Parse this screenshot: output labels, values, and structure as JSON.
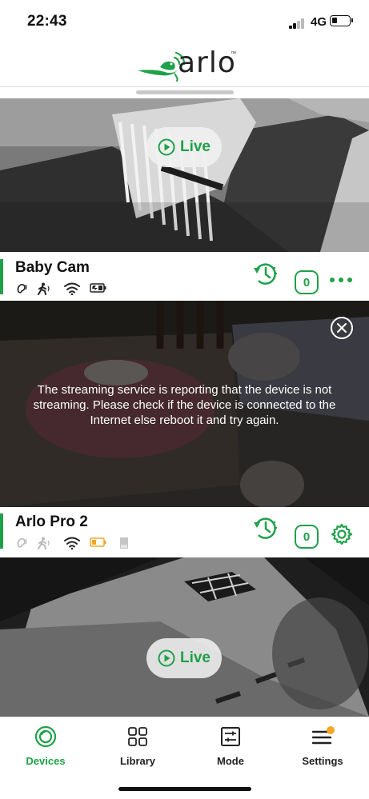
{
  "status_bar": {
    "time": "22:43",
    "network": "4G"
  },
  "header": {
    "logo_text": "arlo",
    "logo_tm": "™"
  },
  "feeds": [
    {
      "name": "Baby Cam",
      "live_label": "Live",
      "status_icons": [
        "sound-icon",
        "motion-icon",
        "wifi-icon",
        "battery-charging-icon"
      ],
      "count": "0",
      "actions": [
        "history-icon",
        "count-badge",
        "more-icon"
      ]
    },
    {
      "name": "Arlo Pro 2",
      "error_message": "The streaming service is reporting that the device is not streaming. Please check if the device is connected to the Internet else reboot it and try again.",
      "status_icons": [
        "sound-icon",
        "motion-icon",
        "wifi-icon",
        "battery-low-icon",
        "sd-card-icon"
      ],
      "count": "0",
      "actions": [
        "history-icon",
        "count-badge",
        "gear-icon"
      ],
      "battery_color": "#f5a623"
    },
    {
      "live_label": "Live"
    }
  ],
  "tabs": [
    {
      "label": "Devices",
      "icon": "devices-icon",
      "active": true
    },
    {
      "label": "Library",
      "icon": "grid-icon",
      "active": false
    },
    {
      "label": "Mode",
      "icon": "sliders-icon",
      "active": false
    },
    {
      "label": "Settings",
      "icon": "menu-icon",
      "active": false,
      "badge": true
    }
  ],
  "colors": {
    "accent": "#1fa149",
    "badge": "#f5a623",
    "warning": "#f5a623"
  }
}
